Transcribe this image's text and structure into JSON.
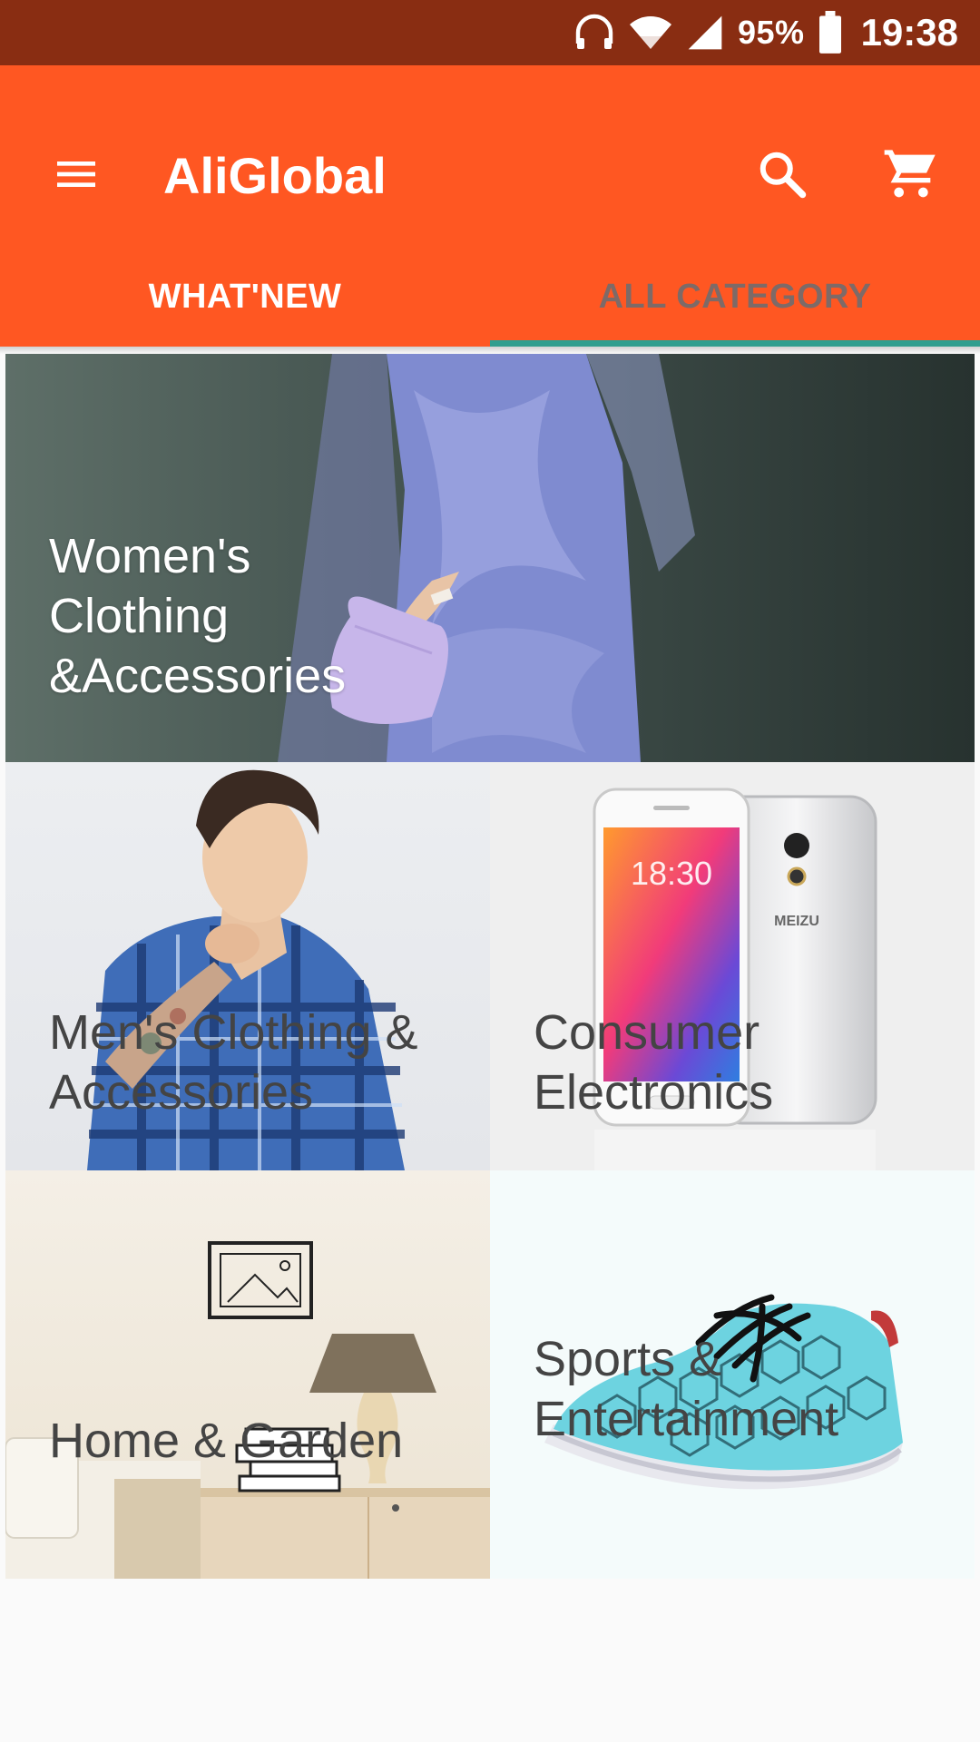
{
  "status_bar": {
    "battery_percent": "95%",
    "time": "19:38",
    "icons": [
      "headphones-icon",
      "wifi-icon",
      "signal-icon",
      "battery-icon"
    ]
  },
  "app_bar": {
    "title": "AliGlobal",
    "icons": [
      "menu-icon",
      "search-icon",
      "cart-icon"
    ],
    "colors": {
      "primary": "#ff5722",
      "status_bar": "#892d12",
      "tab_indicator": "#2f9e8e"
    }
  },
  "tabs": [
    {
      "label": "WHAT'NEW",
      "selected": false
    },
    {
      "label": "ALL CATEGORY",
      "selected": true
    }
  ],
  "categories": [
    {
      "label": "Women's Clothing &Accessories",
      "lines": [
        "Women's",
        "Clothing",
        "&Accessories"
      ]
    },
    {
      "label": "Men's Clothing & Accessories",
      "lines": [
        "Men's Clothing &",
        "Accessories"
      ]
    },
    {
      "label": "Consumer Electronics",
      "lines": [
        "Consumer",
        "Electronics"
      ]
    },
    {
      "label": "Home & Garden",
      "lines": [
        "Home & Garden"
      ]
    },
    {
      "label": "Sports & Entertainment",
      "lines": [
        "Sports &",
        "Entertainment"
      ]
    }
  ],
  "images": {
    "phone_screen_time": "18:30",
    "phone_brand": "MEIZU"
  }
}
